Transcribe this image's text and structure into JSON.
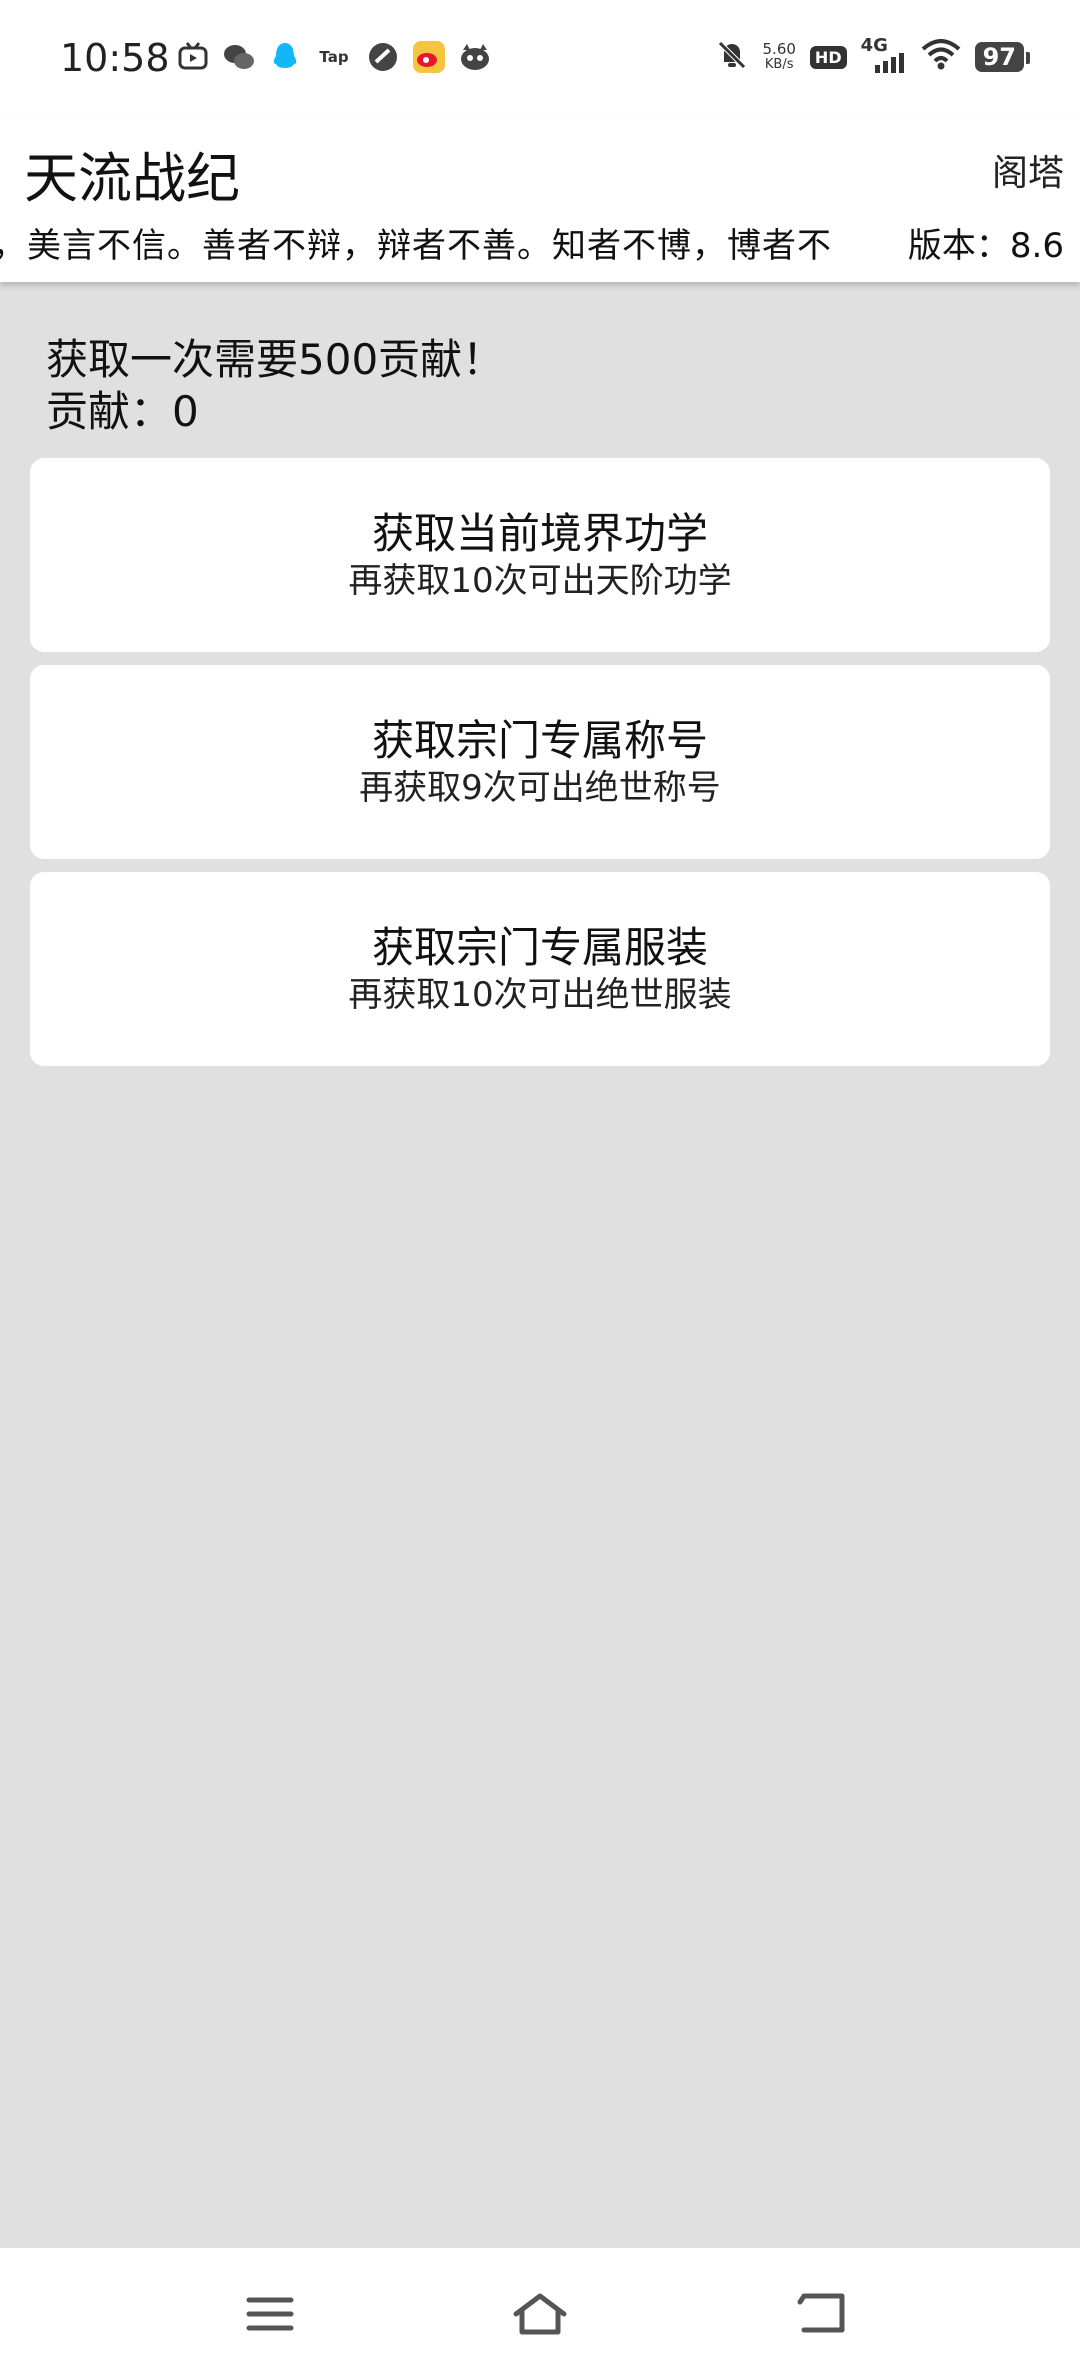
{
  "status_bar": {
    "time": "10:58",
    "net_speed_value": "5.60",
    "net_speed_unit": "KB/s",
    "hd_label": "HD",
    "network_label": "4G",
    "battery": "97",
    "app_icons": [
      "tv-app-icon",
      "wechat-icon",
      "qq-icon",
      "taptap-icon",
      "speed-app-icon",
      "weibo-icon",
      "game-app-icon"
    ],
    "tap_label": "Tap"
  },
  "header": {
    "title": "天流战纪",
    "tower_label": "阁塔",
    "marquee_text": "，美言不信。善者不辩，辩者不善。知者不博，博者不",
    "version": "版本：8.6"
  },
  "info": {
    "cost_text": "获取一次需要500贡献！",
    "contribution_text": "贡献：0"
  },
  "cards": [
    {
      "title": "获取当前境界功学",
      "subtitle": "再获取10次可出天阶功学"
    },
    {
      "title": "获取宗门专属称号",
      "subtitle": "再获取9次可出绝世称号"
    },
    {
      "title": "获取宗门专属服装",
      "subtitle": "再获取10次可出绝世服装"
    }
  ],
  "colors": {
    "background": "#e0e0e0",
    "card": "#ffffff",
    "text": "#111111"
  }
}
